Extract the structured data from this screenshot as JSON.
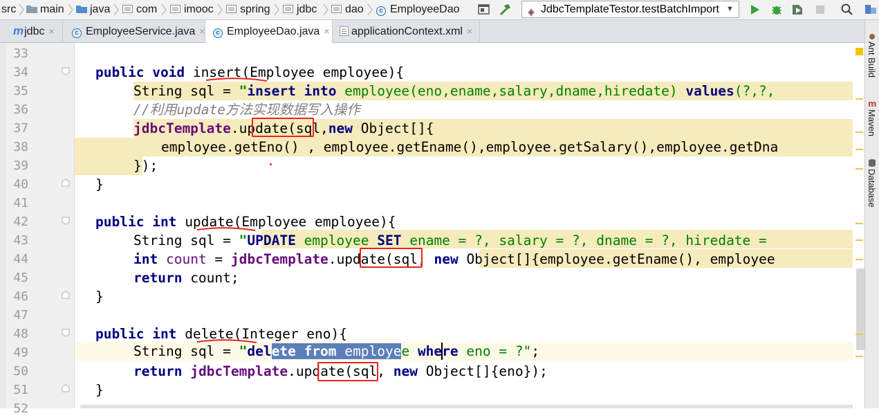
{
  "breadcrumb": [
    "src",
    "main",
    "java",
    "com",
    "imooc",
    "spring",
    "jdbc",
    "dao",
    "EmployeeDao"
  ],
  "toolbar": {
    "run_config": "JdbcTemplateTestor.testBatchImport",
    "run_config_dropdown": "▼",
    "buttons": [
      "layout-icon",
      "build-hammer-icon",
      "run-icon",
      "debug-icon",
      "coverage-icon",
      "stop-icon",
      "search-icon",
      "project-structure-icon"
    ]
  },
  "tabs": [
    {
      "label": "jdbc",
      "logo": "m",
      "active": false
    },
    {
      "label": "EmployeeService.java",
      "active": false
    },
    {
      "label": "EmployeeDao.java",
      "active": true
    },
    {
      "label": "applicationContext.xml",
      "active": false
    }
  ],
  "tab_close": "×",
  "line_numbers": [
    "33",
    "34",
    "35",
    "36",
    "37",
    "38",
    "39",
    "40",
    "41",
    "42",
    "43",
    "44",
    "45",
    "46",
    "47",
    "48",
    "49",
    "50",
    "51",
    "52"
  ],
  "code": {
    "l34": {
      "kw1": "public",
      "kw2": "void",
      "name": "insert",
      "rest": "(Employee employee){"
    },
    "l35": {
      "a": "String sql = ",
      "s1": "\"",
      "s2": "insert into",
      "s3": " employee(eno,ename,salary,dname,hiredate) ",
      "s4": "values",
      "s5": "(?,?,"
    },
    "l36": {
      "comment": "//利用update方法实现数据写入操作"
    },
    "l37": {
      "field": "jdbcTemplate",
      "dot": ".",
      "call": "update",
      "a": "(sql,",
      "kw": "new",
      "b": " Object[]{"
    },
    "l38": {
      "text": "employee.getEno() , employee.getEname(),employee.getSalary(),employee.getDna"
    },
    "l39": {
      "text": "});"
    },
    "l40": {
      "text": "}"
    },
    "l42": {
      "kw1": "public",
      "kw2": "int",
      "name": "update",
      "rest": "(Employee employee){"
    },
    "l43": {
      "a": "String sql = ",
      "s1": "\"",
      "s2": "UPDATE",
      "s3": " employee ",
      "s4": "SET",
      "s5": " ename = ?, salary = ?, dname = ?, hiredate ="
    },
    "l44": {
      "kw": "int",
      "var": "count",
      "eq": " = ",
      "field": "jdbcTemplate",
      "dot": ".",
      "call": "update",
      "a": "(sql, ",
      "kw2": "new",
      "b": " Object[]{employee.getEname(), employee"
    },
    "l45": {
      "kw": "return",
      "rest": " count;"
    },
    "l46": {
      "text": "}"
    },
    "l48": {
      "kw1": "public",
      "kw2": "int",
      "name": "delete",
      "rest": "(Integer eno){"
    },
    "l49": {
      "a": "String sql = ",
      "s1": "\"",
      "s2": "del",
      "sel1": "ete from",
      "sel2": " employe",
      "s3": "e ",
      "s4": "where",
      "s5": " eno = ?\"",
      "end": ";"
    },
    "l50": {
      "kw": "return",
      "sp": " ",
      "field": "jdbcTemplate",
      "dot": ".",
      "call": "update",
      "a": "(sql, ",
      "kw2": "new",
      "b": " Object[]{eno});"
    },
    "l51": {
      "text": "}"
    }
  },
  "right_tools": [
    "Ant Build",
    "Maven",
    "Database"
  ],
  "colors": {
    "keyword": "#000080",
    "string": "#008000",
    "field": "#660e7a",
    "comment": "#808080",
    "annotation_red": "#e8241b",
    "highlight": "#f6ebbc",
    "selection": "#5b7fb9"
  }
}
